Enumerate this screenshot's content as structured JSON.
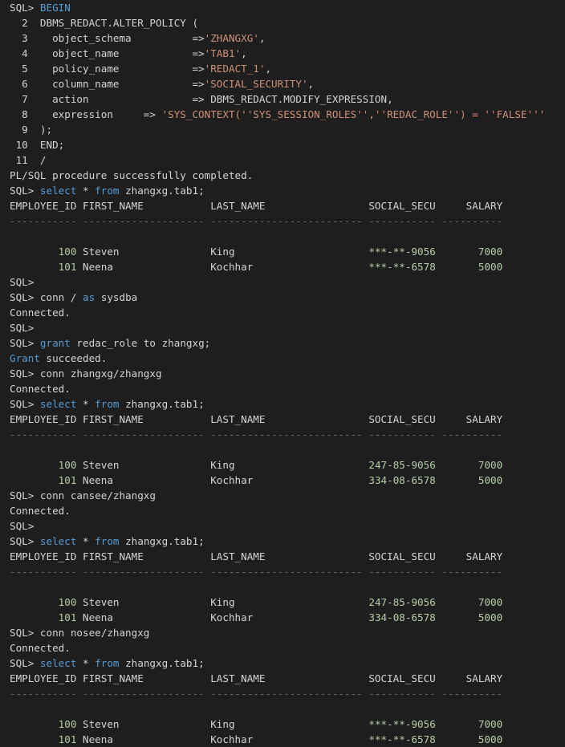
{
  "lines": [
    [
      {
        "t": "SQL> "
      },
      {
        "t": "BEGIN",
        "c": "kw"
      }
    ],
    [
      {
        "t": "  2  DBMS_REDACT.ALTER_POLICY ("
      }
    ],
    [
      {
        "t": "  3    object_schema          =>"
      },
      {
        "t": "'ZHANGXG'",
        "c": "str"
      },
      {
        "t": ","
      }
    ],
    [
      {
        "t": "  4    object_name            =>"
      },
      {
        "t": "'TAB1'",
        "c": "str"
      },
      {
        "t": ","
      }
    ],
    [
      {
        "t": "  5    policy_name            =>"
      },
      {
        "t": "'REDACT_1'",
        "c": "str"
      },
      {
        "t": ","
      }
    ],
    [
      {
        "t": "  6    column_name            =>"
      },
      {
        "t": "'SOCIAL_SECURITY'",
        "c": "str"
      },
      {
        "t": ","
      }
    ],
    [
      {
        "t": "  7    action                 => DBMS_REDACT.MODIFY_EXPRESSION,"
      }
    ],
    [
      {
        "t": "  8    expression     => "
      },
      {
        "t": "'SYS_CONTEXT(''SYS_SESSION_ROLES'',''REDAC_ROLE'') = ''FALSE'''",
        "c": "str"
      }
    ],
    [
      {
        "t": "  9  );"
      }
    ],
    [
      {
        "t": " 10  END;"
      }
    ],
    [
      {
        "t": " 11  /"
      }
    ],
    [
      {
        "t": "PL/SQL procedure successfully completed."
      }
    ],
    [
      {
        "t": "SQL> "
      },
      {
        "t": "select",
        "c": "kw"
      },
      {
        "t": " * "
      },
      {
        "t": "from",
        "c": "kw"
      },
      {
        "t": " zhangxg.tab1;"
      }
    ],
    [
      {
        "t": "EMPLOYEE_ID FIRST_NAME           LAST_NAME                 SOCIAL_SECU     SALARY"
      }
    ],
    [
      {
        "t": "----------- -------------------- ------------------------- ----------- ----------",
        "c": "dash"
      }
    ],
    [
      {
        "t": ""
      }
    ],
    [
      {
        "t": "        "
      },
      {
        "t": "100",
        "c": "num"
      },
      {
        "t": " Steven               King                      "
      },
      {
        "t": "***-**-9056",
        "c": "num"
      },
      {
        "t": "       "
      },
      {
        "t": "7000",
        "c": "num"
      }
    ],
    [
      {
        "t": "        "
      },
      {
        "t": "101",
        "c": "num"
      },
      {
        "t": " Neena                Kochhar                   "
      },
      {
        "t": "***-**-6578",
        "c": "num"
      },
      {
        "t": "       "
      },
      {
        "t": "5000",
        "c": "num"
      }
    ],
    [
      {
        "t": "SQL>"
      }
    ],
    [
      {
        "t": "SQL> conn / "
      },
      {
        "t": "as",
        "c": "kw"
      },
      {
        "t": " sysdba"
      }
    ],
    [
      {
        "t": "Connected."
      }
    ],
    [
      {
        "t": "SQL>"
      }
    ],
    [
      {
        "t": "SQL> "
      },
      {
        "t": "grant",
        "c": "kw"
      },
      {
        "t": " redac_role to zhangxg;"
      }
    ],
    [
      {
        "t": "Grant",
        "c": "kw"
      },
      {
        "t": " succeeded."
      }
    ],
    [
      {
        "t": "SQL> conn zhangxg/zhangxg"
      }
    ],
    [
      {
        "t": "Connected."
      }
    ],
    [
      {
        "t": "SQL> "
      },
      {
        "t": "select",
        "c": "kw"
      },
      {
        "t": " * "
      },
      {
        "t": "from",
        "c": "kw"
      },
      {
        "t": " zhangxg.tab1;"
      }
    ],
    [
      {
        "t": "EMPLOYEE_ID FIRST_NAME           LAST_NAME                 SOCIAL_SECU     SALARY"
      }
    ],
    [
      {
        "t": "----------- -------------------- ------------------------- ----------- ----------",
        "c": "dash"
      }
    ],
    [
      {
        "t": ""
      }
    ],
    [
      {
        "t": "        "
      },
      {
        "t": "100",
        "c": "num"
      },
      {
        "t": " Steven               King                      "
      },
      {
        "t": "247-85-9056",
        "c": "num"
      },
      {
        "t": "       "
      },
      {
        "t": "7000",
        "c": "num"
      }
    ],
    [
      {
        "t": "        "
      },
      {
        "t": "101",
        "c": "num"
      },
      {
        "t": " Neena                Kochhar                   "
      },
      {
        "t": "334-08-6578",
        "c": "num"
      },
      {
        "t": "       "
      },
      {
        "t": "5000",
        "c": "num"
      }
    ],
    [
      {
        "t": "SQL> conn cansee/zhangxg"
      }
    ],
    [
      {
        "t": "Connected."
      }
    ],
    [
      {
        "t": "SQL>"
      }
    ],
    [
      {
        "t": "SQL> "
      },
      {
        "t": "select",
        "c": "kw"
      },
      {
        "t": " * "
      },
      {
        "t": "from",
        "c": "kw"
      },
      {
        "t": " zhangxg.tab1;"
      }
    ],
    [
      {
        "t": "EMPLOYEE_ID FIRST_NAME           LAST_NAME                 SOCIAL_SECU     SALARY"
      }
    ],
    [
      {
        "t": "----------- -------------------- ------------------------- ----------- ----------",
        "c": "dash"
      }
    ],
    [
      {
        "t": ""
      }
    ],
    [
      {
        "t": "        "
      },
      {
        "t": "100",
        "c": "num"
      },
      {
        "t": " Steven               King                      "
      },
      {
        "t": "247-85-9056",
        "c": "num"
      },
      {
        "t": "       "
      },
      {
        "t": "7000",
        "c": "num"
      }
    ],
    [
      {
        "t": "        "
      },
      {
        "t": "101",
        "c": "num"
      },
      {
        "t": " Neena                Kochhar                   "
      },
      {
        "t": "334-08-6578",
        "c": "num"
      },
      {
        "t": "       "
      },
      {
        "t": "5000",
        "c": "num"
      }
    ],
    [
      {
        "t": "SQL> conn nosee/zhangxg"
      }
    ],
    [
      {
        "t": "Connected."
      }
    ],
    [
      {
        "t": "SQL> "
      },
      {
        "t": "select",
        "c": "kw"
      },
      {
        "t": " * "
      },
      {
        "t": "from",
        "c": "kw"
      },
      {
        "t": " zhangxg.tab1;"
      }
    ],
    [
      {
        "t": "EMPLOYEE_ID FIRST_NAME           LAST_NAME                 SOCIAL_SECU     SALARY"
      }
    ],
    [
      {
        "t": "----------- -------------------- ------------------------- ----------- ----------",
        "c": "dash"
      }
    ],
    [
      {
        "t": ""
      }
    ],
    [
      {
        "t": "        "
      },
      {
        "t": "100",
        "c": "num"
      },
      {
        "t": " Steven               King                      "
      },
      {
        "t": "***-**-9056",
        "c": "num"
      },
      {
        "t": "       "
      },
      {
        "t": "7000",
        "c": "num"
      }
    ],
    [
      {
        "t": "        "
      },
      {
        "t": "101",
        "c": "num"
      },
      {
        "t": " Neena                Kochhar                   "
      },
      {
        "t": "***-**-6578",
        "c": "num"
      },
      {
        "t": "       "
      },
      {
        "t": "5000",
        "c": "num"
      }
    ]
  ]
}
